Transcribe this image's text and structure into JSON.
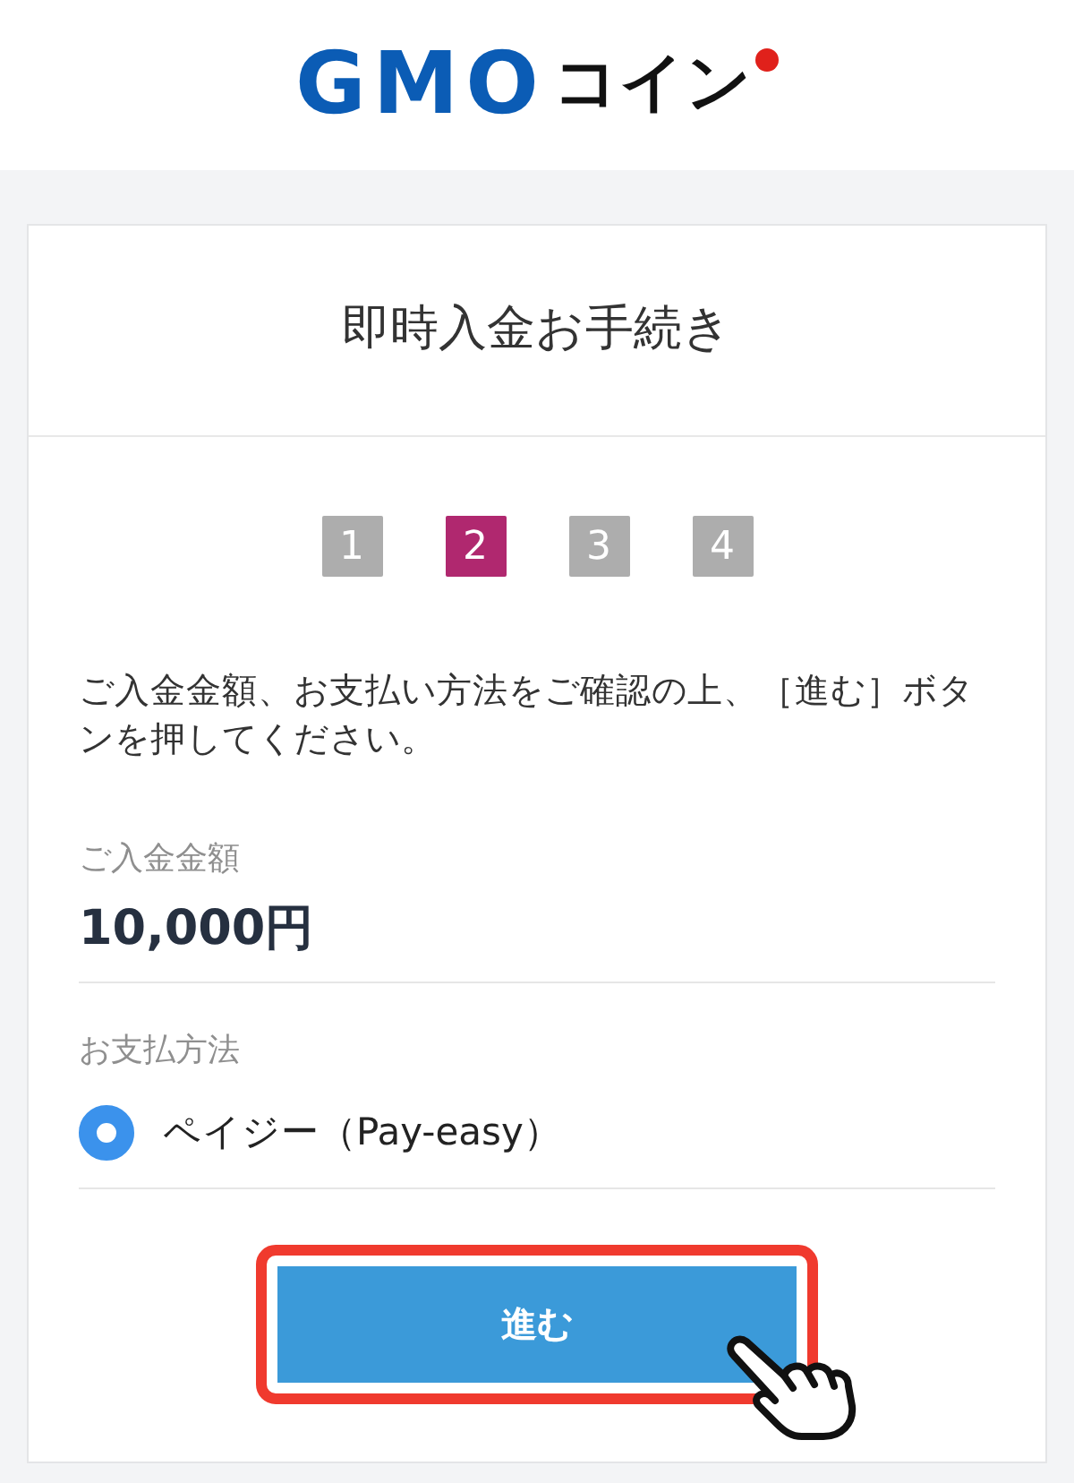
{
  "header": {
    "logo": {
      "brand": "GMO",
      "name": "コイン"
    }
  },
  "card": {
    "title": "即時入金お手続き",
    "steps": [
      {
        "label": "1",
        "selected": false
      },
      {
        "label": "2",
        "selected": true
      },
      {
        "label": "3",
        "selected": false
      },
      {
        "label": "4",
        "selected": false
      }
    ],
    "instructions": "ご入金金額、お支払い方法をご確認の上、［進む］ボタンを押してください。",
    "amount": {
      "label": "ご入金金額",
      "value": "10,000円"
    },
    "payment": {
      "label": "お支払方法",
      "options": [
        {
          "label": "ペイジー（Pay-easy）",
          "selected": true
        }
      ]
    },
    "button": {
      "label": "進む",
      "highlighted": true
    }
  }
}
